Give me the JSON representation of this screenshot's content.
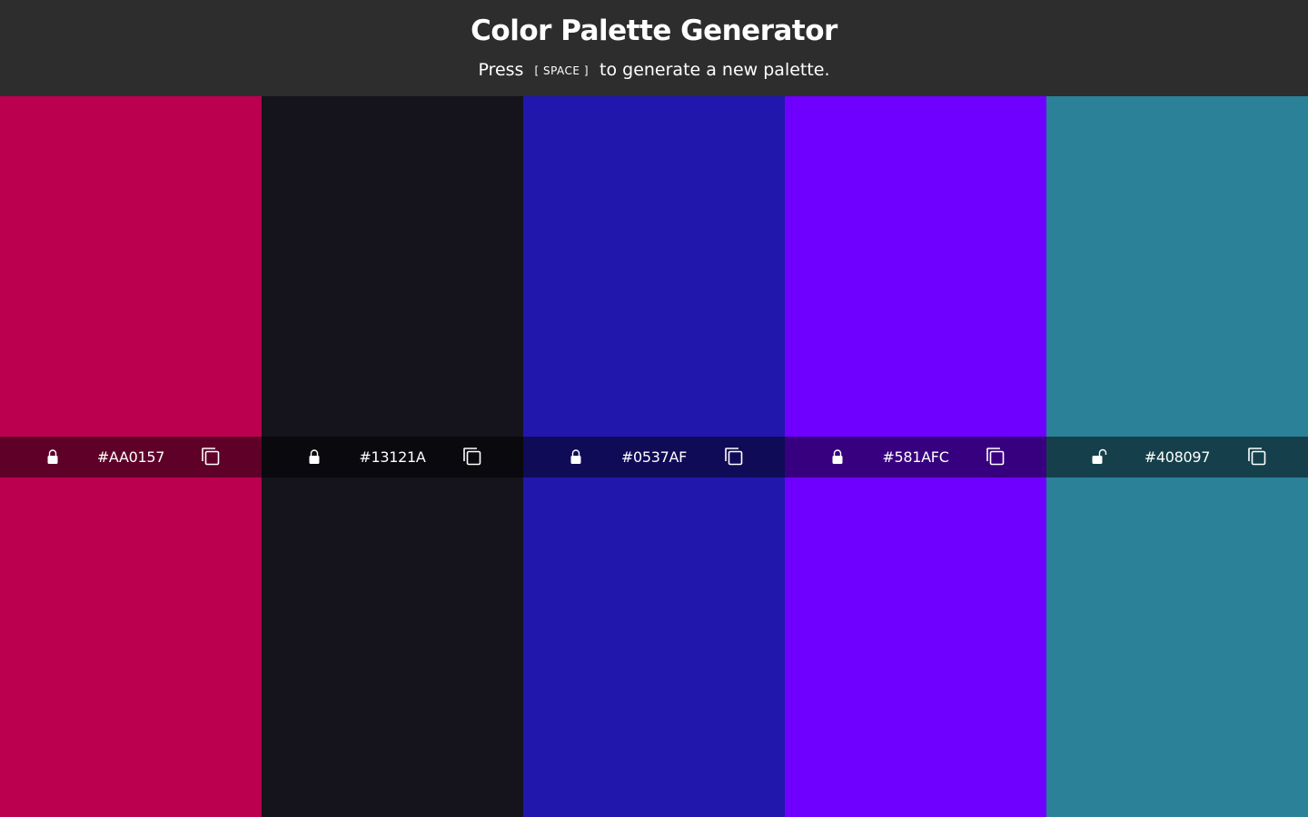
{
  "header": {
    "title": "Color Palette Generator",
    "subtitle_before": "Press",
    "key_hint": "[ SPACE ]",
    "subtitle_after": "to generate a new palette."
  },
  "swatches": [
    {
      "hex": "#AA0157",
      "color": "#bc0050",
      "locked": true
    },
    {
      "hex": "#13121A",
      "color": "#15131c",
      "locked": true
    },
    {
      "hex": "#0537AF",
      "color": "#2117ad",
      "locked": true
    },
    {
      "hex": "#581AFC",
      "color": "#6f00ff",
      "locked": true
    },
    {
      "hex": "#408097",
      "color": "#2b8197",
      "locked": false
    }
  ],
  "icons": {
    "lock": "lock-icon",
    "unlock": "unlock-icon",
    "copy": "copy-icon"
  }
}
